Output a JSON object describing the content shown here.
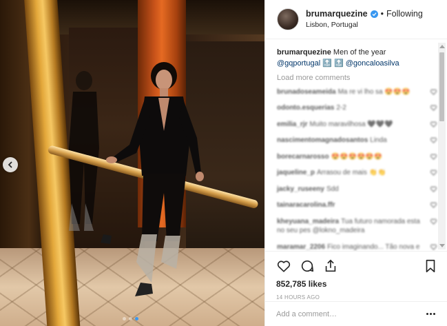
{
  "post": {
    "username": "brumarquezine",
    "follow_state": "Following",
    "separator": "•",
    "location": "Lisbon, Portugal",
    "verified_icon": "verified-badge-icon"
  },
  "caption": {
    "user": "brumarquezine",
    "text": "Men of the year",
    "mention_1": "@gqportugal",
    "emoji": "🔝 🔝",
    "mention_2": "@goncaloasilva"
  },
  "load_more": "Load more comments",
  "comments": [
    {
      "user": "brunadoseameida",
      "text": "Ma re vi lho sa 😍😍😍"
    },
    {
      "user": "odonto.esquerias",
      "text": "2-2"
    },
    {
      "user": "emilia_rjr",
      "text": "Muito maravilhosa 🖤🖤🖤"
    },
    {
      "user": "nascimentomagnadosantos",
      "text": "Linda"
    },
    {
      "user": "borecarnarosso",
      "text": "😍😍😍😍😍😍"
    },
    {
      "user": "jaqueline_p",
      "text": "Arrasou de mais 👏👏"
    },
    {
      "user": "jacky_ruseeny",
      "text": "Sdd"
    },
    {
      "user": "tainaracarolina.ffr",
      "text": ""
    },
    {
      "user": "kheyuana_madeira",
      "text": "Tua futuro namorada esta no seu pes @lokno_madeira"
    },
    {
      "user": "maramar_2206",
      "text": "Fico imaginando... Tão nova e tão valente. Orgulho de vc."
    }
  ],
  "actions": {
    "like_icon": "heart-icon",
    "comment_icon": "comment-icon",
    "share_icon": "share-icon",
    "save_icon": "bookmark-icon"
  },
  "likes": "852,785 likes",
  "timestamp": "14 HOURS AGO",
  "add_comment_placeholder": "Add a comment…",
  "colors": {
    "link": "#003569",
    "accent": "#3897f0",
    "muted": "#999999",
    "text": "#262626"
  }
}
